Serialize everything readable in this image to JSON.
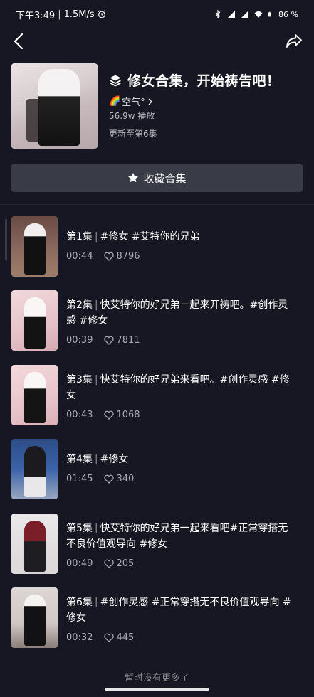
{
  "status_bar": {
    "time": "下午3:49",
    "network_speed": "1.5M/s",
    "battery": "86 %"
  },
  "collection": {
    "title": "修女合集，开始祷告吧！",
    "author_emoji": "🌈",
    "author": "空气°",
    "plays": "56.9w 播放",
    "updated": "更新至第6集",
    "collect_label": "收藏合集"
  },
  "episodes": [
    {
      "ep": "第1集",
      "title": "#修女 #艾特你的兄弟",
      "duration": "00:44",
      "likes": "8796"
    },
    {
      "ep": "第2集",
      "title": "快艾特你的好兄弟一起来开祷吧。#创作灵感 #修女",
      "duration": "00:39",
      "likes": "7811"
    },
    {
      "ep": "第3集",
      "title": "快艾特你的好兄弟来看吧。#创作灵感 #修女",
      "duration": "00:43",
      "likes": "1068"
    },
    {
      "ep": "第4集",
      "title": "#修女",
      "duration": "01:45",
      "likes": "340"
    },
    {
      "ep": "第5集",
      "title": "快艾特你的好兄弟一起来看吧#正常穿搭无不良价值观导向 #修女",
      "duration": "00:49",
      "likes": "205"
    },
    {
      "ep": "第6集",
      "title": "#创作灵感 #正常穿搭无不良价值观导向 #修女",
      "duration": "00:32",
      "likes": "445"
    }
  ],
  "footer": {
    "no_more": "暂时没有更多了"
  },
  "colors": {
    "background": "#161722",
    "button": "#393b47",
    "muted_text": "#a8a8b2"
  },
  "icons": [
    "back-icon",
    "share-icon",
    "layers-icon",
    "star-icon",
    "heart-icon",
    "chevron-right-icon",
    "bluetooth-icon",
    "signal-icon",
    "wifi-icon",
    "battery-icon",
    "alarm-icon"
  ]
}
